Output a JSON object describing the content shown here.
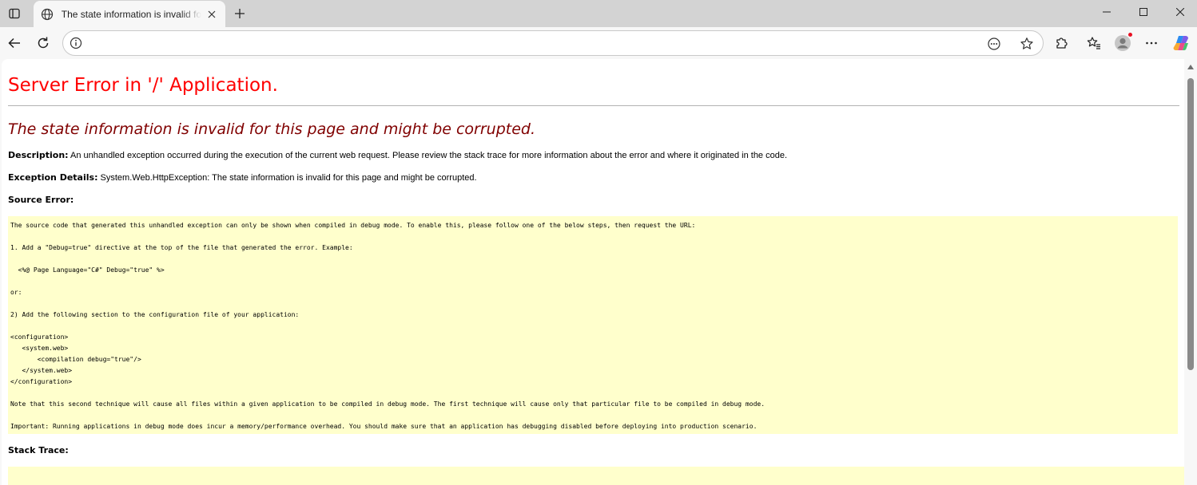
{
  "browser": {
    "tab_title": "The state information is invalid for this page and might be corrupted.",
    "address_value": "",
    "icons": {
      "tab_actions": "tab-actions-icon",
      "favicon": "globe-icon",
      "close": "close-icon",
      "new_tab": "plus-icon",
      "back": "back-arrow-icon",
      "reload": "reload-icon",
      "site_info": "info-icon",
      "read_aloud": "reader-icon",
      "favorite": "star-icon",
      "extensions": "puzzle-icon",
      "favorites": "favorites-icon",
      "profile": "avatar",
      "menu": "more-icon",
      "copilot": "copilot-icon"
    },
    "colors": {
      "chrome": "#d3d3d3",
      "toolbar": "#f7f7f7",
      "notification_dot": "#e81123"
    }
  },
  "page": {
    "title": "Server Error in '/' Application.",
    "error_message": "The state information is invalid for this page and might be corrupted.",
    "description_label": "Description:",
    "description_text": " An unhandled exception occurred during the execution of the current web request. Please review the stack trace for more information about the error and where it originated in the code.",
    "exception_label": "Exception Details:",
    "exception_text": " System.Web.HttpException: The state information is invalid for this page and might be corrupted.",
    "source_error_heading": "Source Error:",
    "source_error_lines": [
      "The source code that generated this unhandled exception can only be shown when compiled in debug mode. To enable this, please follow one of the below steps, then request the URL:",
      "",
      "1. Add a \"Debug=true\" directive at the top of the file that generated the error. Example:",
      "",
      "  <%@ Page Language=\"C#\" Debug=\"true\" %>",
      "",
      "or:",
      "",
      "2) Add the following section to the configuration file of your application:",
      "",
      "<configuration>",
      "   <system.web>",
      "       <compilation debug=\"true\"/>",
      "   </system.web>",
      "</configuration>",
      "",
      "Note that this second technique will cause all files within a given application to be compiled in debug mode. The first technique will cause only that particular file to be compiled in debug mode.",
      "",
      "Important: Running applications in debug mode does incur a memory/performance overhead. You should make sure that an application has debugging disabled before deploying into production scenario."
    ],
    "stack_trace_heading": "Stack Trace:",
    "colors": {
      "title": "#ff0000",
      "error_message": "#800000",
      "code_background": "#ffffcc"
    }
  }
}
